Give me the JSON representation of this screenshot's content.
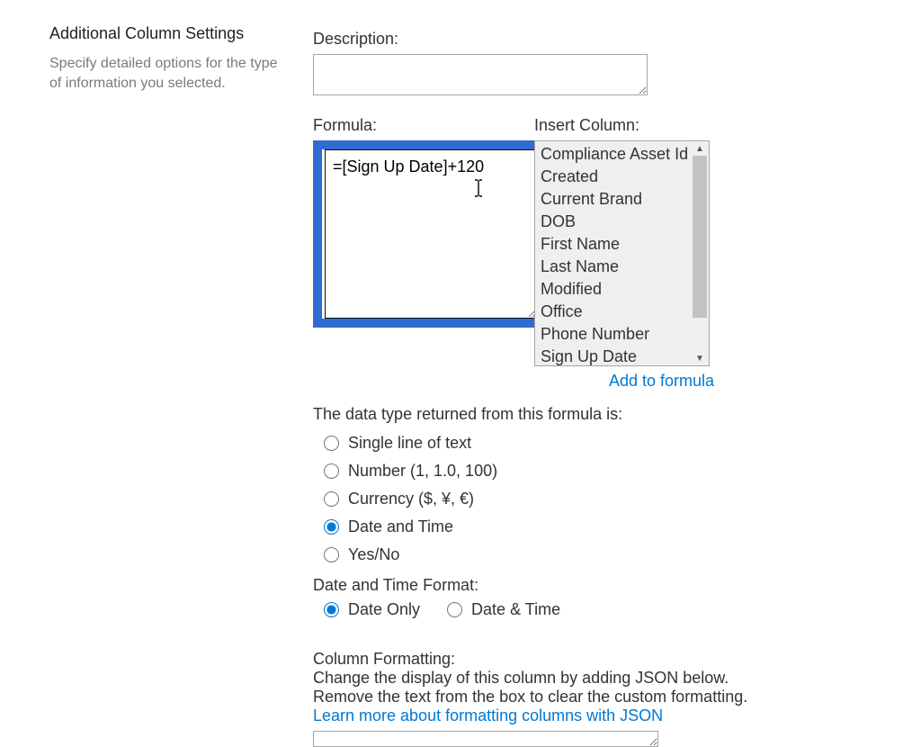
{
  "left": {
    "title": "Additional Column Settings",
    "help": "Specify detailed options for the type of information you selected."
  },
  "description": {
    "label": "Description:",
    "value": ""
  },
  "formula": {
    "label": "Formula:",
    "value": "=[Sign Up Date]+120"
  },
  "insert": {
    "label": "Insert Column:",
    "items": [
      "Compliance Asset Id",
      "Created",
      "Current Brand",
      "DOB",
      "First Name",
      "Last Name",
      "Modified",
      "Office",
      "Phone Number",
      "Sign Up Date"
    ],
    "add_link": "Add to formula"
  },
  "datatype": {
    "label": "The data type returned from this formula is:",
    "options": {
      "text": "Single line of text",
      "number": "Number (1, 1.0, 100)",
      "currency": "Currency ($, ¥, €)",
      "datetime": "Date and Time",
      "yesno": "Yes/No"
    },
    "selected": "datetime"
  },
  "dtformat": {
    "label": "Date and Time Format:",
    "options": {
      "dateonly": "Date Only",
      "datetime": "Date & Time"
    },
    "selected": "dateonly"
  },
  "formatting": {
    "heading": "Column Formatting:",
    "line1": "Change the display of this column by adding JSON below.",
    "line2": "Remove the text from the box to clear the custom formatting.",
    "link": "Learn more about formatting columns with JSON"
  }
}
